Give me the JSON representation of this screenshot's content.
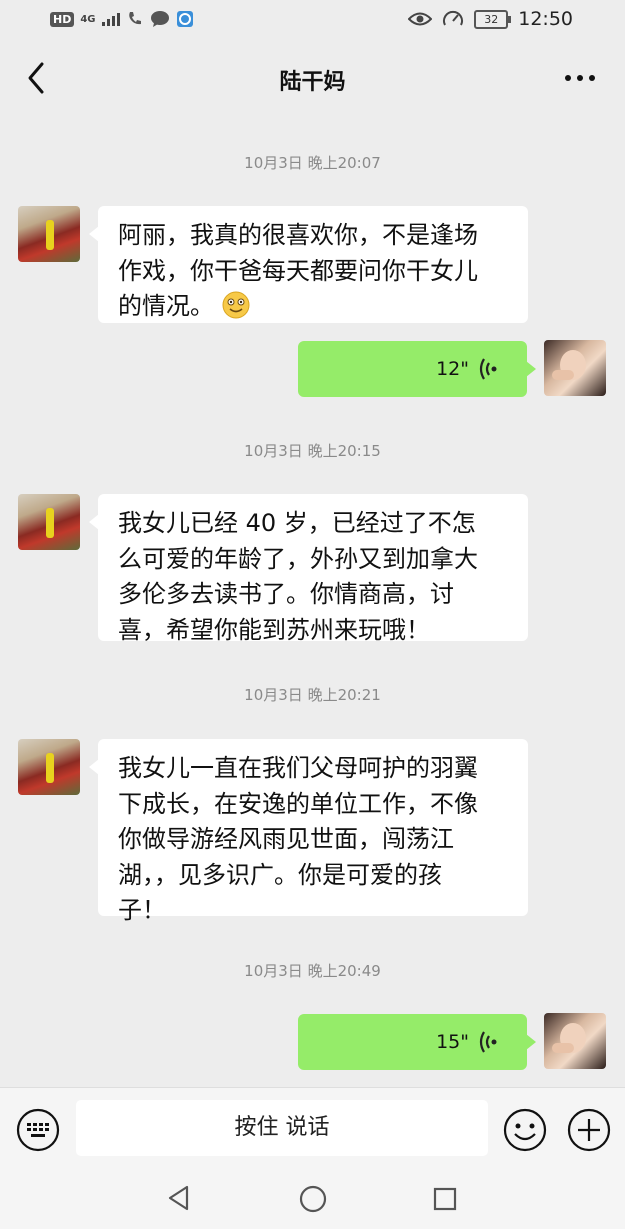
{
  "status_bar": {
    "hd": "HD",
    "network": "4G",
    "battery": "32",
    "time": "12:50"
  },
  "header": {
    "title": "陆干妈"
  },
  "messages": [
    {
      "type": "time",
      "text": "10月3日 晚上20:07"
    },
    {
      "type": "text",
      "side": "left",
      "lines": [
        "阿丽，我真的很喜欢你，不是逢场",
        "作戏，你干爸每天都要问你干女儿",
        "的情况。"
      ],
      "emoji": "smile-emoji"
    },
    {
      "type": "voice",
      "side": "right",
      "duration": "12\""
    },
    {
      "type": "time",
      "text": "10月3日 晚上20:15"
    },
    {
      "type": "text",
      "side": "left",
      "lines": [
        "我女儿已经 40 岁，已经过了不怎",
        "么可爱的年龄了，外孙又到加拿大",
        "多伦多去读书了。你情商高，讨",
        "喜，希望你能到苏州来玩哦！"
      ]
    },
    {
      "type": "time",
      "text": "10月3日 晚上20:21"
    },
    {
      "type": "text",
      "side": "left",
      "lines": [
        "我女儿一直在我们父母呵护的羽翼",
        "下成长，在安逸的单位工作，不像",
        "你做导游经风雨见世面，闯荡江",
        "湖，，见多识广。你是可爱的孩",
        "子！"
      ]
    },
    {
      "type": "time",
      "text": "10月3日 晚上20:49"
    },
    {
      "type": "voice",
      "side": "right",
      "duration": "15\""
    }
  ],
  "input_bar": {
    "hold_to_talk": "按住 说话"
  },
  "colors": {
    "background": "#ededed",
    "voice_bubble": "#95ec69",
    "text_bubble": "#ffffff"
  }
}
